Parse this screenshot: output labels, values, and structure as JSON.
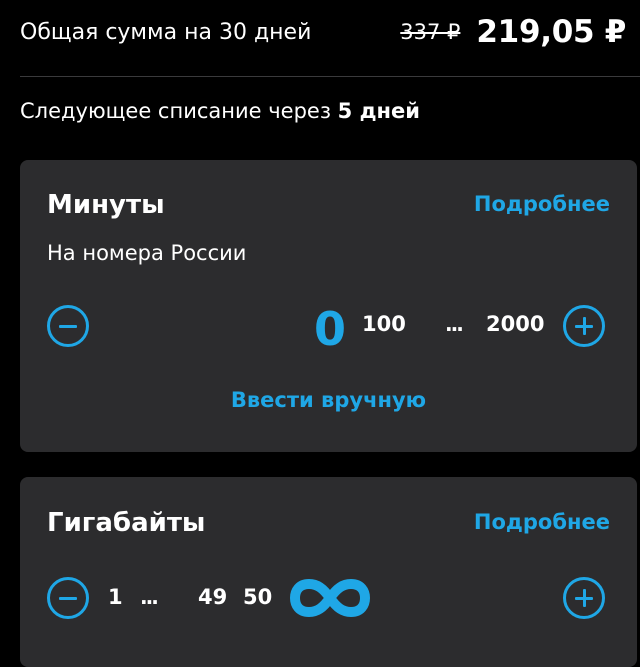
{
  "summary": {
    "label": "Общая сумма на 30 дней",
    "old_price": "337 ₽",
    "new_price": "219,05 ₽"
  },
  "next_charge": {
    "prefix": "Следующее списание через ",
    "highlight": "5 дней"
  },
  "minutes": {
    "title": "Минуты",
    "more_label": "Подробнее",
    "subtitle": "На номера России",
    "selected_value": "0",
    "steps": [
      "100",
      "2000"
    ],
    "ellipsis": "...",
    "manual_label": "Ввести вручную"
  },
  "gigabytes": {
    "title": "Гигабайты",
    "more_label": "Подробнее",
    "steps": [
      "1",
      "49",
      "50"
    ],
    "ellipsis": "...",
    "selected_icon": "infinity-icon"
  },
  "colors": {
    "background": "#000000",
    "card": "#2c2c2e",
    "accent": "#1fa7e6",
    "text": "#ffffff"
  },
  "icons": {
    "minus": "minus-circle-icon",
    "plus": "plus-circle-icon",
    "unlimited": "infinity-icon"
  }
}
